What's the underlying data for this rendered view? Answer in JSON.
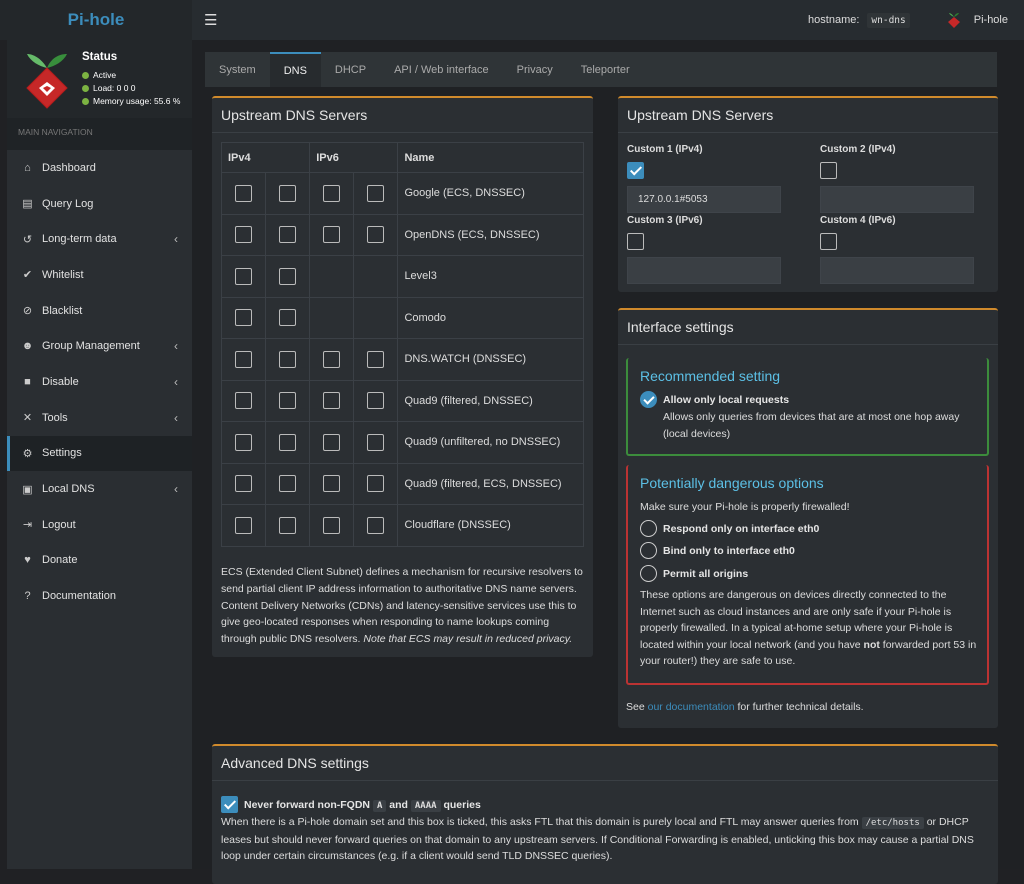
{
  "brand": "Pi-hole",
  "topbar": {
    "host_label": "hostname:",
    "host_value": "wn-dns",
    "user": "Pi-hole"
  },
  "status": {
    "title": "Status",
    "active": "Active",
    "load": "Load:  0  0  0",
    "memory": "Memory usage:  55.6 %"
  },
  "nav_header": "MAIN NAVIGATION",
  "nav": [
    {
      "label": "Dashboard",
      "icon": "dashboard-icon"
    },
    {
      "label": "Query Log",
      "icon": "file-icon"
    },
    {
      "label": "Long-term data",
      "icon": "history-icon"
    },
    {
      "label": "Whitelist",
      "icon": "check-circle-icon"
    },
    {
      "label": "Blacklist",
      "icon": "ban-icon"
    },
    {
      "label": "Group Management",
      "icon": "users-icon"
    },
    {
      "label": "Disable",
      "icon": "stop-icon"
    },
    {
      "label": "Tools",
      "icon": "wrench-icon"
    },
    {
      "label": "Settings",
      "icon": "gear-icon"
    },
    {
      "label": "Local DNS",
      "icon": "address-book-icon"
    },
    {
      "label": "Logout",
      "icon": "logout-icon"
    },
    {
      "label": "Donate",
      "icon": "donate-icon"
    },
    {
      "label": "Documentation",
      "icon": "question-icon"
    }
  ],
  "tabs": [
    "System",
    "DNS",
    "DHCP",
    "API / Web interface",
    "Privacy",
    "Teleporter"
  ],
  "upstream": {
    "title": "Upstream DNS Servers",
    "headers": {
      "ipv4": "IPv4",
      "ipv6": "IPv6",
      "name": "Name"
    },
    "rows": [
      {
        "name": "Google (ECS, DNSSEC)",
        "v6": true
      },
      {
        "name": "OpenDNS (ECS, DNSSEC)",
        "v6": true
      },
      {
        "name": "Level3",
        "v6": false
      },
      {
        "name": "Comodo",
        "v6": false
      },
      {
        "name": "DNS.WATCH (DNSSEC)",
        "v6": true
      },
      {
        "name": "Quad9 (filtered, DNSSEC)",
        "v6": true
      },
      {
        "name": "Quad9 (unfiltered, no DNSSEC)",
        "v6": true
      },
      {
        "name": "Quad9 (filtered, ECS, DNSSEC)",
        "v6": true
      },
      {
        "name": "Cloudflare (DNSSEC)",
        "v6": true
      }
    ],
    "ecs_text": "ECS (Extended Client Subnet) defines a mechanism for recursive resolvers to send partial client IP address information to authoritative DNS name servers. Content Delivery Networks (CDNs) and latency-sensitive services use this to give geo-located responses when responding to name lookups coming through public DNS resolvers.",
    "ecs_note": "Note that ECS may result in reduced privacy."
  },
  "custom": {
    "title": "Upstream DNS Servers",
    "c1": "Custom 1 (IPv4)",
    "c2": "Custom 2 (IPv4)",
    "c3": "Custom 3 (IPv6)",
    "c4": "Custom 4 (IPv6)",
    "c1_value": "127.0.0.1#5053"
  },
  "iface": {
    "title": "Interface settings",
    "rec_title": "Recommended setting",
    "local_label": "Allow only local requests",
    "local_desc": "Allows only queries from devices that are at most one hop away (local devices)",
    "danger_title": "Potentially dangerous options",
    "danger_intro": "Make sure your Pi-hole is properly firewalled!",
    "opt1": "Respond only on interface eth0",
    "opt2": "Bind only to interface eth0",
    "opt3": "Permit all origins",
    "danger_desc_a": "These options are dangerous on devices directly connected to the Internet such as cloud instances and are only safe if your Pi-hole is properly firewalled. In a typical at-home setup where your Pi-hole is located within your local network (and you have ",
    "danger_not": "not",
    "danger_desc_b": " forwarded port 53 in your router!) they are safe to use.",
    "see": "See ",
    "doc_link": "our documentation",
    "see_after": " for further technical details."
  },
  "advanced": {
    "title": "Advanced DNS settings",
    "fqdn_a": "Never forward non-FQDN ",
    "code_a": "A",
    "fqdn_and": " and ",
    "code_aaaa": "AAAA",
    "fqdn_b": " queries",
    "desc_a": "When there is a Pi-hole domain set and this box is ticked, this asks FTL that this domain is purely local and FTL may answer queries from ",
    "code_hosts": "/etc/hosts",
    "desc_b": " or DHCP leases but should never forward queries on that domain to any upstream servers. If Conditional Forwarding is enabled, unticking this box may cause a partial DNS loop under certain circumstances (e.g. if a client would send TLD DNSSEC queries)."
  }
}
